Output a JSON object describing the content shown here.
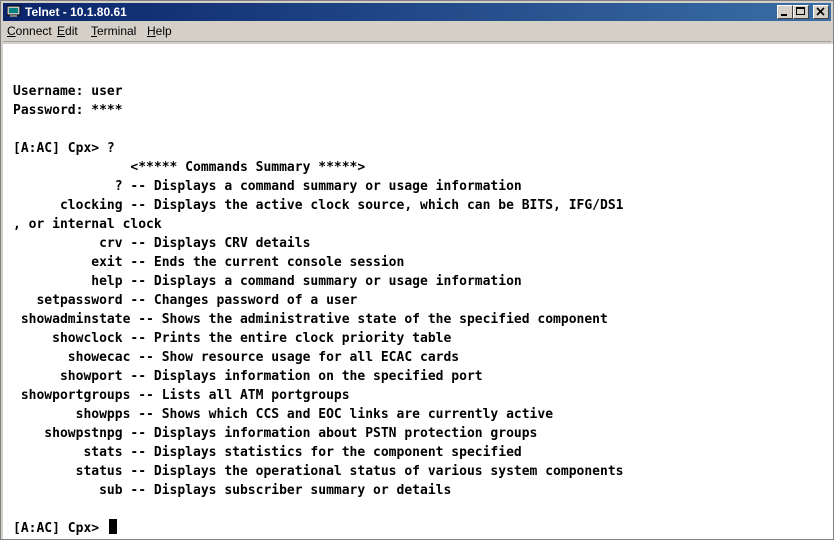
{
  "window": {
    "title": "Telnet - 10.1.80.61"
  },
  "titlebar_icons": {
    "app": "telnet-app-icon",
    "minimize": "minimize-icon",
    "maximize": "maximize-icon",
    "close": "close-icon"
  },
  "menu": [
    {
      "acc": "C",
      "rest": "onnect"
    },
    {
      "acc": "E",
      "rest": "dit"
    },
    {
      "acc": "T",
      "rest": "erminal"
    },
    {
      "acc": "H",
      "rest": "elp"
    }
  ],
  "terminal": {
    "lines": [
      "Username: user",
      "Password: ****",
      "",
      "[A:AC] Cpx> ?",
      "               <***** Commands Summary *****>",
      "             ? -- Displays a command summary or usage information",
      "      clocking -- Displays the active clock source, which can be BITS, IFG/DS1",
      ", or internal clock",
      "           crv -- Displays CRV details",
      "          exit -- Ends the current console session",
      "          help -- Displays a command summary or usage information",
      "   setpassword -- Changes password of a user",
      " showadminstate -- Shows the administrative state of the specified component",
      "     showclock -- Prints the entire clock priority table",
      "       showecac -- Show resource usage for all ECAC cards",
      "      showport -- Displays information on the specified port",
      " showportgroups -- Lists all ATM portgroups",
      "        showpps -- Shows which CCS and EOC links are currently active",
      "    showpstnpg -- Displays information about PSTN protection groups",
      "         stats -- Displays statistics for the component specified",
      "        status -- Displays the operational status of various system components",
      "           sub -- Displays subscriber summary or details",
      ""
    ],
    "prompt": "[A:AC] Cpx> "
  }
}
